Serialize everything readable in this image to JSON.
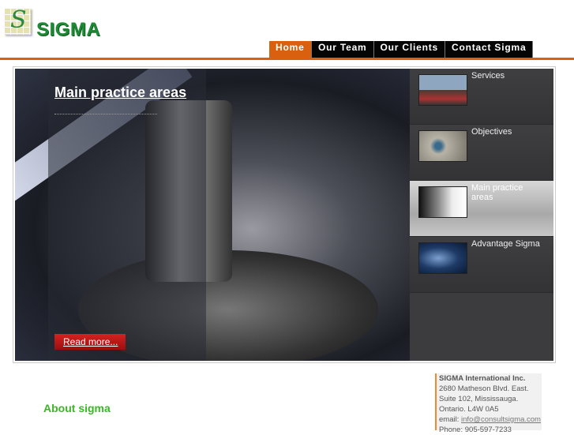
{
  "logo": {
    "text": "SIGMA"
  },
  "nav": [
    "Home",
    "Our Team",
    "Our Clients",
    "Contact Sigma"
  ],
  "hero": {
    "title": "Main practice areas",
    "read_more": "Read more..."
  },
  "side_items": [
    {
      "label": "Services",
      "thumb": "#7d8fa5"
    },
    {
      "label": "Objectives",
      "thumb": "#8a8678"
    },
    {
      "label": "Main practice areas",
      "thumb": "#bfc3cc"
    },
    {
      "label": "Advantage Sigma",
      "thumb": "#22406a"
    }
  ],
  "about": {
    "heading": "About sigma"
  },
  "address": {
    "company": "SIGMA International Inc.",
    "line1": "2680 Matheson Blvd. East.",
    "line2": "Suite 102, Mississauga.",
    "line3": "Ontario. L4W 0A5",
    "email_label": "email:",
    "email": "info@consultsigma.com",
    "phone": "Phone: 905-597-7233"
  }
}
